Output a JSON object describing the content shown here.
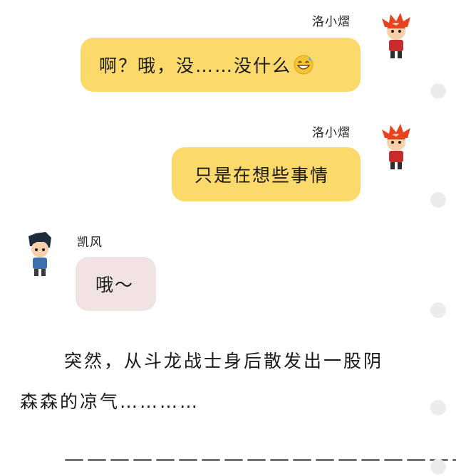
{
  "messages": [
    {
      "side": "right",
      "sender": "洛小熠",
      "text": "啊？哦，没……没什么",
      "emoji": "grinning-sweat-emoji"
    },
    {
      "side": "right",
      "sender": "洛小熠",
      "text": "只是在想些事情"
    },
    {
      "side": "left",
      "sender": "凯风",
      "text": "哦～"
    }
  ],
  "narration": {
    "line1": "突然，从斗龙战士身后散发出一股阴",
    "line2": "森森的凉气…………"
  },
  "divider": "——————————————————",
  "colors": {
    "right_bubble": "#fcd96b",
    "left_bubble": "#f1e3e3",
    "dot": "#ececec"
  },
  "icons": {
    "right_avatar": "red-haired-boy-avatar",
    "left_avatar": "dark-haired-boy-avatar"
  }
}
